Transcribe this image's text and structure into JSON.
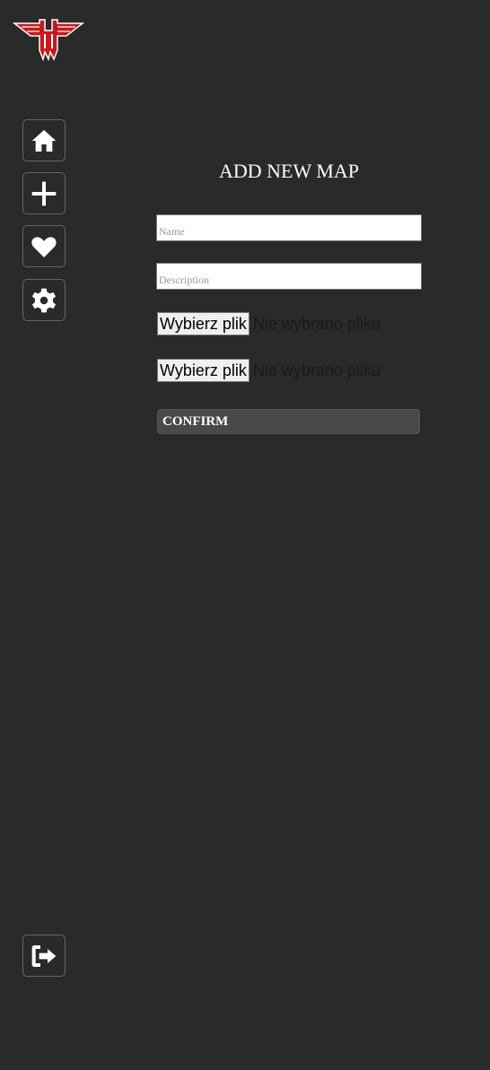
{
  "logo": {
    "name": "wolfenstein-logo",
    "colors": {
      "primary": "#c8181e",
      "outline": "#ffffff"
    }
  },
  "sidebar": {
    "items": [
      {
        "icon": "home-icon"
      },
      {
        "icon": "plus-icon"
      },
      {
        "icon": "heart-icon"
      },
      {
        "icon": "gear-icon"
      }
    ],
    "logout": {
      "icon": "logout-icon"
    }
  },
  "form": {
    "title": "ADD NEW MAP",
    "name_placeholder": "Name",
    "description_placeholder": "Description",
    "files": [
      {
        "button": "Wybierz plik",
        "status": "Nie wybrano pliku"
      },
      {
        "button": "Wybierz plik",
        "status": "Nie wybrano pliku"
      }
    ],
    "confirm_label": "CONFIRM"
  },
  "colors": {
    "background": "#2a2a2a",
    "button": "#4a4a4a"
  }
}
